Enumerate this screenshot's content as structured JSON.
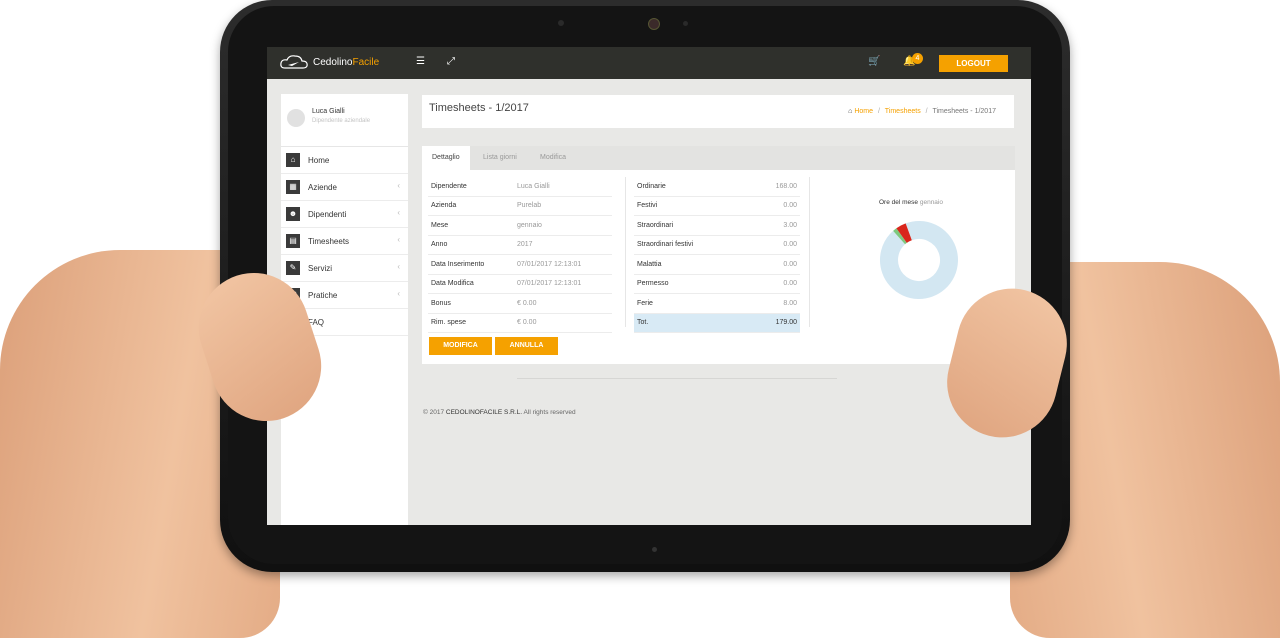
{
  "app": {
    "logo_part1": "Cedolino",
    "logo_part2": "Facile",
    "logout_label": "LOGOUT",
    "notification_count": "4"
  },
  "user": {
    "name": "Luca Gialli",
    "role": "Dipendente aziendale"
  },
  "sidebar": {
    "items": [
      {
        "label": "Home",
        "icon": "home-icon"
      },
      {
        "label": "Aziende",
        "icon": "building-icon"
      },
      {
        "label": "Dipendenti",
        "icon": "users-icon"
      },
      {
        "label": "Timesheets",
        "icon": "calendar-icon"
      },
      {
        "label": "Servizi",
        "icon": "wrench-icon"
      },
      {
        "label": "Pratiche",
        "icon": "folder-icon"
      },
      {
        "label": "FAQ",
        "icon": "question-icon"
      }
    ]
  },
  "page": {
    "title": "Timesheets - 1/2017"
  },
  "breadcrumb": {
    "home": "Home",
    "section": "Timesheets",
    "current": "Timesheets - 1/2017"
  },
  "tabs": [
    "Dettaglio",
    "Lista giorni",
    "Modifica"
  ],
  "details": [
    {
      "k": "Dipendente",
      "v": "Luca Gialli"
    },
    {
      "k": "Azienda",
      "v": "Purelab"
    },
    {
      "k": "Mese",
      "v": "gennaio"
    },
    {
      "k": "Anno",
      "v": "2017"
    },
    {
      "k": "Data Inserimento",
      "v": "07/01/2017 12:13:01"
    },
    {
      "k": "Data Modifica",
      "v": "07/01/2017 12:13:01"
    },
    {
      "k": "Bonus",
      "v": "€ 0.00"
    },
    {
      "k": "Rim. spese",
      "v": "€ 0.00"
    }
  ],
  "hours": [
    {
      "k": "Ordinarie",
      "v": "168.00"
    },
    {
      "k": "Festivi",
      "v": "0.00"
    },
    {
      "k": "Straordinari",
      "v": "3.00"
    },
    {
      "k": "Straordinari festivi",
      "v": "0.00"
    },
    {
      "k": "Malattia",
      "v": "0.00"
    },
    {
      "k": "Permesso",
      "v": "0.00"
    },
    {
      "k": "Ferie",
      "v": "8.00"
    },
    {
      "k": "Tot.",
      "v": "179.00"
    }
  ],
  "chart": {
    "title": "Ore del mese",
    "month": "gennaio"
  },
  "chart_data": {
    "type": "pie",
    "categories": [
      "Ordinarie",
      "Straordinari",
      "Ferie"
    ],
    "values": [
      168,
      3,
      8
    ],
    "colors": [
      "#d3e7f2",
      "#7ec87e",
      "#d9261c"
    ]
  },
  "buttons": {
    "edit": "MODIFICA",
    "cancel": "ANNULLA"
  },
  "footer": {
    "prefix": "© 2017 ",
    "company": "CEDOLINOFACILE S.R.L.",
    "suffix": " All rights reserved"
  }
}
